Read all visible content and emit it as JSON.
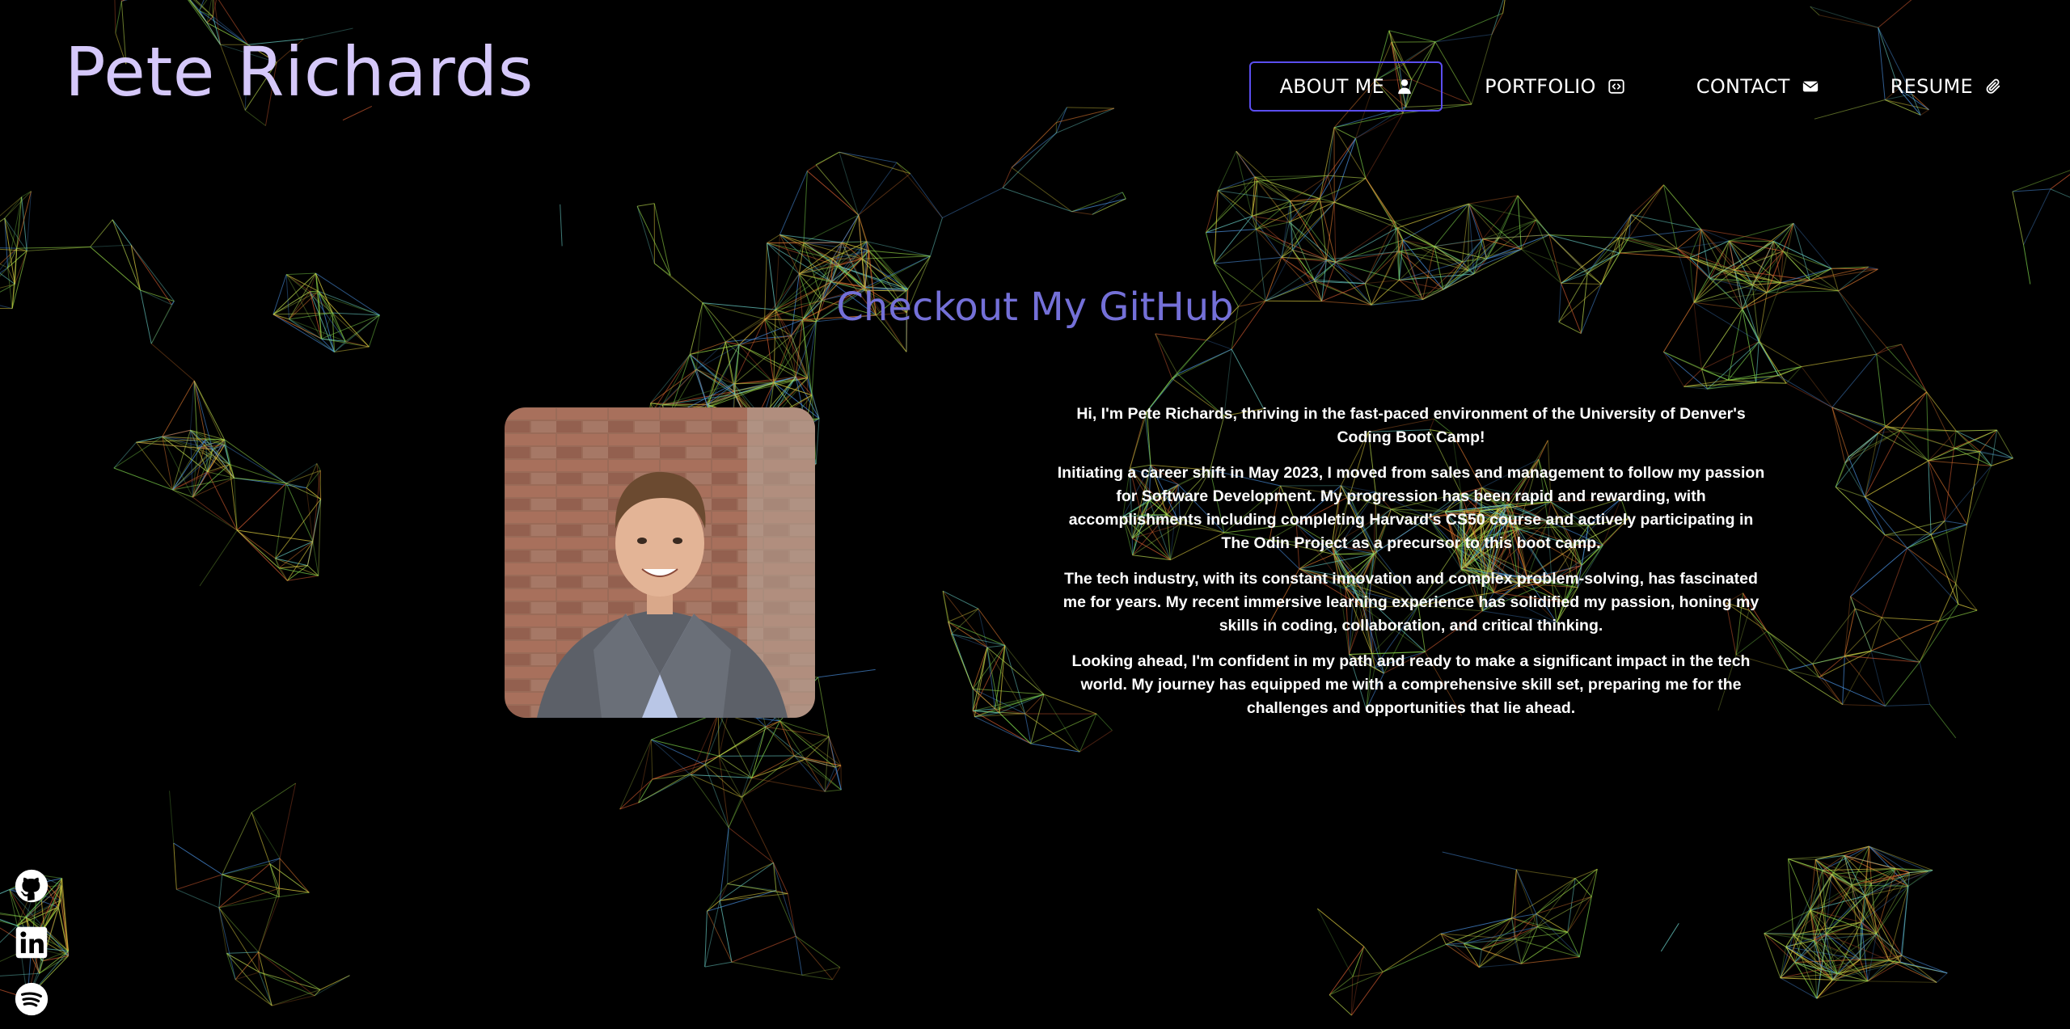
{
  "colors": {
    "title": "#d5c8fa",
    "heading": "#7470d8",
    "nav_active_border": "#5b4ef0",
    "background": "#000000"
  },
  "header": {
    "title": "Pete Richards"
  },
  "nav": {
    "items": [
      {
        "label": "ABOUT ME",
        "icon": "user-icon",
        "active": true
      },
      {
        "label": "PORTFOLIO",
        "icon": "code-icon",
        "active": false
      },
      {
        "label": "CONTACT",
        "icon": "envelope-icon",
        "active": false
      },
      {
        "label": "RESUME",
        "icon": "paperclip-icon",
        "active": false
      }
    ]
  },
  "main": {
    "heading": "Checkout My GitHub",
    "bio": [
      "Hi, I'm Pete Richards, thriving in the fast-paced environment of the University of Denver's Coding Boot Camp!",
      "Initiating a career shift in May 2023, I moved from sales and management to follow my passion for Software Development. My progression has been rapid and rewarding, with accomplishments including completing Harvard's CS50 course and actively participating in The Odin Project as a precursor to this boot camp.",
      "The tech industry, with its constant innovation and complex problem-solving, has fascinated me for years. My recent immersive learning experience has solidified my passion, honing my skills in coding, collaboration, and critical thinking.",
      "Looking ahead, I'm confident in my path and ready to make a significant impact in the tech world. My journey has equipped me with a comprehensive skill set, preparing me for the challenges and opportunities that lie ahead."
    ]
  },
  "social": [
    {
      "icon": "github-icon"
    },
    {
      "icon": "linkedin-icon"
    },
    {
      "icon": "spotify-icon"
    }
  ]
}
